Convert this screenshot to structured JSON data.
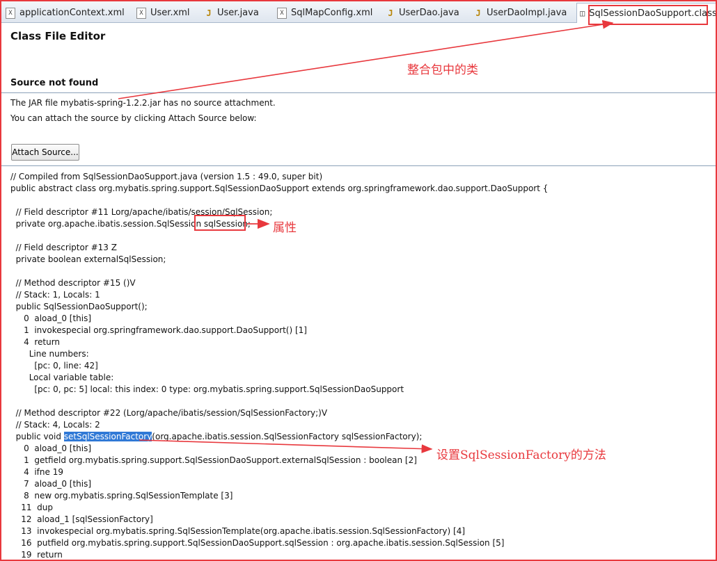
{
  "tabs": [
    {
      "label": "applicationContext.xml",
      "icon": "xml-file-icon",
      "glyph": "X"
    },
    {
      "label": "User.xml",
      "icon": "xml-file-icon",
      "glyph": "X"
    },
    {
      "label": "User.java",
      "icon": "java-file-icon",
      "glyph": "J"
    },
    {
      "label": "SqlMapConfig.xml",
      "icon": "xml-file-icon",
      "glyph": "X"
    },
    {
      "label": "UserDao.java",
      "icon": "java-file-icon",
      "glyph": "J"
    },
    {
      "label": "UserDaoImpl.java",
      "icon": "java-file-icon",
      "glyph": "J"
    },
    {
      "label": "SqlSessionDaoSupport.class",
      "icon": "class-file-icon",
      "glyph": "◫"
    }
  ],
  "editor": {
    "title": "Class File Editor",
    "source_not_found": "Source not found",
    "jar_message": "The JAR file mybatis-spring-1.2.2.jar has no source attachment.",
    "attach_hint": "You can attach the source by clicking Attach Source below:",
    "attach_button": "Attach Source..."
  },
  "code_lines": [
    "// Compiled from SqlSessionDaoSupport.java (version 1.5 : 49.0, super bit)",
    "public abstract class org.mybatis.spring.support.SqlSessionDaoSupport extends org.springframework.dao.support.DaoSupport {",
    "",
    "  // Field descriptor #11 Lorg/apache/ibatis/session/SqlSession;",
    "  private org.apache.ibatis.session.SqlSession sqlSession;",
    "",
    "  // Field descriptor #13 Z",
    "  private boolean externalSqlSession;",
    "",
    "  // Method descriptor #15 ()V",
    "  // Stack: 1, Locals: 1",
    "  public SqlSessionDaoSupport();",
    "     0  aload_0 [this]",
    "     1  invokespecial org.springframework.dao.support.DaoSupport() [1]",
    "     4  return",
    "       Line numbers:",
    "         [pc: 0, line: 42]",
    "       Local variable table:",
    "         [pc: 0, pc: 5] local: this index: 0 type: org.mybatis.spring.support.SqlSessionDaoSupport",
    "",
    "  // Method descriptor #22 (Lorg/apache/ibatis/session/SqlSessionFactory;)V",
    "  // Stack: 4, Locals: 2",
    "  public void setSqlSessionFactory(org.apache.ibatis.session.SqlSessionFactory sqlSessionFactory);",
    "     0  aload_0 [this]",
    "     1  getfield org.mybatis.spring.support.SqlSessionDaoSupport.externalSqlSession : boolean [2]",
    "     4  ifne 19",
    "     7  aload_0 [this]",
    "     8  new org.mybatis.spring.SqlSessionTemplate [3]",
    "    11  dup",
    "    12  aload_1 [sqlSessionFactory]",
    "    13  invokespecial org.mybatis.spring.SqlSessionTemplate(org.apache.ibatis.session.SqlSessionFactory) [4]",
    "    16  putfield org.mybatis.spring.support.SqlSessionDaoSupport.sqlSession : org.apache.ibatis.session.SqlSession [5]",
    "    19  return"
  ],
  "highlight": {
    "line": 22,
    "text": "setSqlSessionFactory"
  },
  "annotations": {
    "integration_class": "整合包中的类",
    "property": "属性",
    "setter_method": "设置SqlSessionFactory的方法"
  },
  "colors": {
    "annotation": "#e8383d",
    "selection": "#3079d6"
  }
}
